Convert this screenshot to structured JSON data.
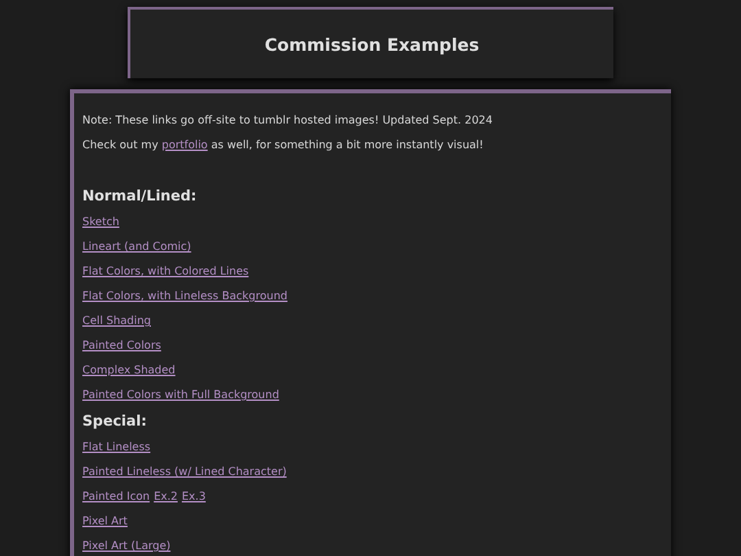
{
  "header": {
    "title": "Commission Examples"
  },
  "intro": [
    {
      "before": "Note: These links go off-site to tumblr hosted images! Updated Sept. 2024"
    },
    {
      "before": "Check out my ",
      "link": "portfolio",
      "after": " as well, for something a bit more instantly visual!"
    }
  ],
  "sections": [
    {
      "heading": "Normal/Lined:",
      "rows": [
        [
          "Sketch"
        ],
        [
          "Lineart (and Comic)"
        ],
        [
          "Flat Colors, with Colored Lines"
        ],
        [
          "Flat Colors, with Lineless Background"
        ],
        [
          "Cell Shading"
        ],
        [
          "Painted Colors"
        ],
        [
          "Complex Shaded"
        ],
        [
          "Painted Colors with Full Background"
        ]
      ]
    },
    {
      "heading": "Special:",
      "rows": [
        [
          "Flat Lineless"
        ],
        [
          "Painted Lineless (w/ Lined Character)"
        ],
        [
          "Painted Icon",
          "Ex.2",
          "Ex.3"
        ],
        [
          "Pixel Art"
        ],
        [
          "Pixel Art (Large)"
        ]
      ]
    }
  ]
}
